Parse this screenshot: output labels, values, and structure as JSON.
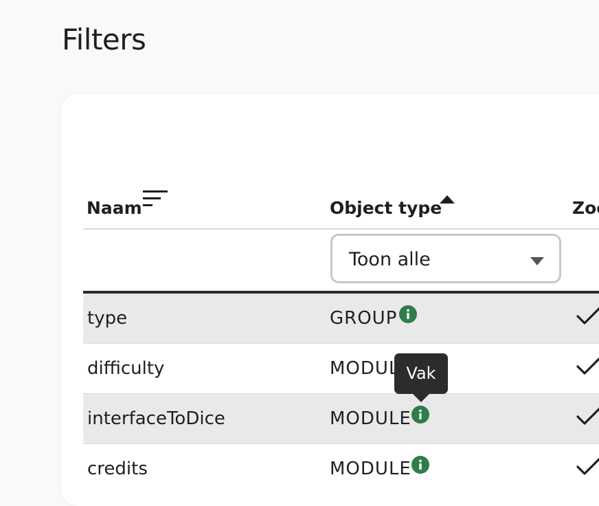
{
  "page": {
    "title": "Filters"
  },
  "table": {
    "columns": [
      {
        "label": "Naam",
        "sort_icon": "sort-lines-icon"
      },
      {
        "label": "Object type",
        "sort_icon": "sort-ascending-icon"
      },
      {
        "label": "Zoe"
      }
    ],
    "filter": {
      "object_type_selected": "Toon alle"
    },
    "rows": [
      {
        "name": "type",
        "object_type": "GROUP",
        "info_icon": "info-icon",
        "checked": true
      },
      {
        "name": "difficulty",
        "object_type": "MODULE",
        "info_icon": "info-icon",
        "checked": true
      },
      {
        "name": "interfaceToDice",
        "object_type": "MODULE",
        "info_icon": "info-icon",
        "checked": true
      },
      {
        "name": "credits",
        "object_type": "MODULE",
        "info_icon": "info-icon",
        "checked": true
      }
    ]
  },
  "tooltip": {
    "text": "Vak"
  },
  "colors": {
    "info_green": "#2e7d4a",
    "row_shade": "#e9e9e9",
    "tooltip_bg": "#2c2c2c"
  }
}
